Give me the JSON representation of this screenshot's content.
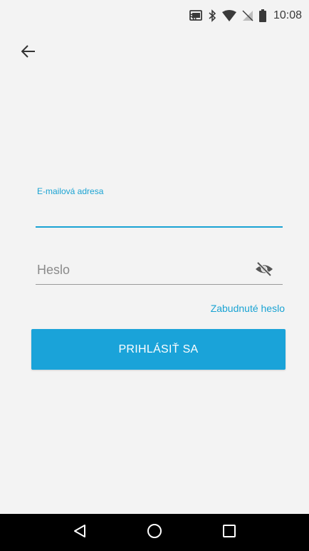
{
  "status_bar": {
    "time": "10:08",
    "icons": [
      "cast-icon",
      "bluetooth-icon",
      "wifi-icon",
      "no-sim-icon",
      "battery-icon"
    ]
  },
  "header": {
    "back_icon": "arrow-left-icon"
  },
  "form": {
    "email_label": "E-mailová adresa",
    "email_value": "",
    "password_placeholder": "Heslo",
    "password_value": "",
    "password_toggle_icon": "eye-off-icon",
    "forgot_password": "Zabudnuté heslo",
    "login_button": "PRIHLÁSIŤ SA"
  },
  "nav_bar": {
    "items": [
      "back-triangle-icon",
      "home-circle-icon",
      "recents-square-icon"
    ]
  },
  "colors": {
    "accent": "#1aa3d3",
    "button": "#1aa3d9",
    "background": "#f3f3f3",
    "nav_bar": "#000000"
  }
}
